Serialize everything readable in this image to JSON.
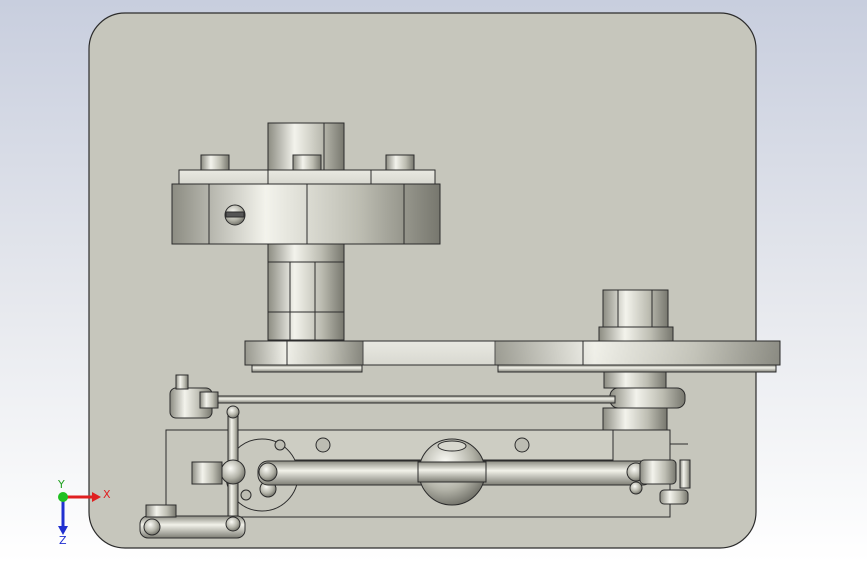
{
  "viewport": {
    "background_top": "#c8cede",
    "background_bottom": "#ffffff"
  },
  "model": {
    "plate_color": "#c6c6bc",
    "metal_color": "#c4c4b8",
    "edge_color": "#2c2c2c"
  },
  "triad": {
    "x_label": "X",
    "y_label": "Y",
    "z_label": "Z",
    "x_color": "#e02020",
    "y_color": "#20c020",
    "z_color": "#2030d0"
  }
}
